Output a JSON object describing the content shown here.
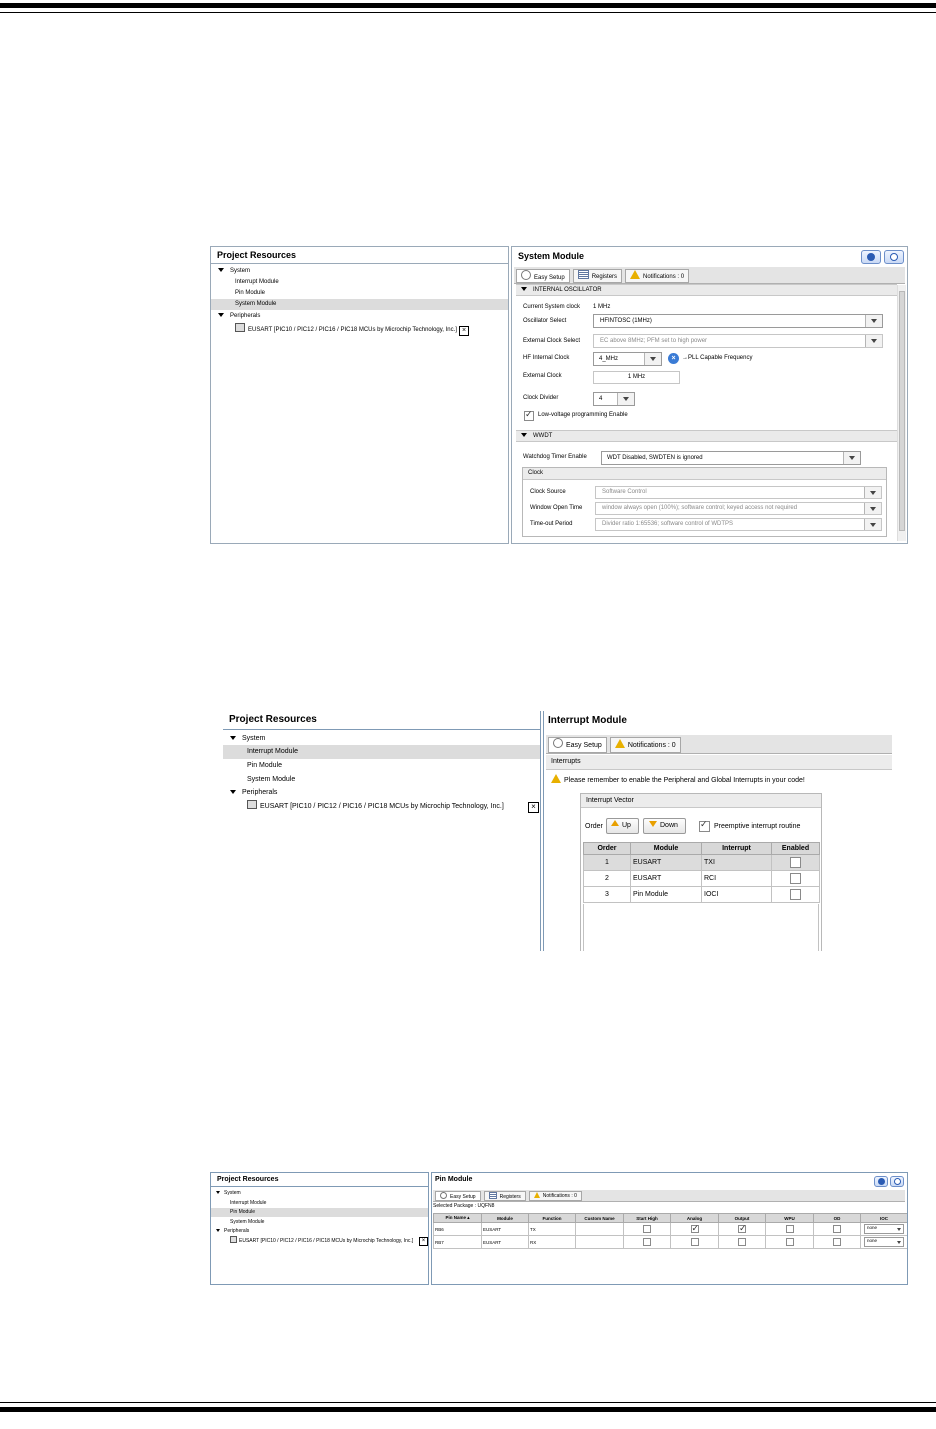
{
  "shot1": {
    "project_resources": {
      "title": "Project Resources",
      "system_label": "System",
      "interrupt_module": "Interrupt Module",
      "pin_module": "Pin Module",
      "system_module": "System Module",
      "peripherals_label": "Peripherals",
      "eusart": "EUSART [PIC10 / PIC12 / PIC16 / PIC18 MCUs  by Microchip Technology, Inc.]"
    },
    "system_module": {
      "title": "System Module",
      "tabs": [
        "Easy Setup",
        "Registers",
        "Notifications : 0"
      ],
      "internal_osc_header": "INTERNAL OSCILLATOR",
      "current_clock_label": "Current System clock",
      "current_clock_value": "1 MHz",
      "osc_select_label": "Oscillator Select",
      "osc_select_value": "HFINTOSC (1MHz)",
      "ext_clock_select_label": "External Clock Select",
      "ext_clock_select_value": "EC above 8MHz; PFM set to high power",
      "hf_internal_clock_label": "HF Internal Clock",
      "hf_internal_clock_value": "4_MHz",
      "pll_label": "PLL Capable Frequency",
      "external_clock_label": "External Clock",
      "external_clock_value": "1 MHz",
      "clock_divider_label": "Clock Divider",
      "clock_divider_value": "4",
      "lvp_label": "Low-voltage programming Enable",
      "wwdt_header": "WWDT",
      "wdt_enable_label": "Watchdog Timer Enable",
      "wdt_enable_value": "WDT Disabled, SWDTEN is ignored",
      "clock_group": "Clock",
      "clock_source_label": "Clock Source",
      "clock_source_value": "Software Control",
      "window_open_label": "Window Open Time",
      "window_open_value": "window always open (100%); software control; keyed access not required",
      "timeout_label": "Time-out Period",
      "timeout_value": "Divider ratio 1:65536; software control of WDTPS"
    }
  },
  "shot2": {
    "project_resources": {
      "title": "Project Resources",
      "system_label": "System",
      "interrupt_module": "Interrupt Module",
      "pin_module": "Pin Module",
      "system_module": "System Module",
      "peripherals_label": "Peripherals",
      "eusart": "EUSART [PIC10 / PIC12 / PIC16 / PIC18 MCUs  by Microchip Technology, Inc.]"
    },
    "interrupt_module": {
      "title": "Interrupt Module",
      "tabs": [
        "Easy Setup",
        "Notifications : 0"
      ],
      "section": "Interrupts",
      "warning": "Please remember to enable the Peripheral and Global Interrupts in your code!",
      "vector_group": "Interrupt Vector",
      "order_label": "Order",
      "up_label": "Up",
      "down_label": "Down",
      "preemptive_label": "Preemptive interrupt routine",
      "columns": [
        "Order",
        "Module",
        "Interrupt",
        "Enabled"
      ],
      "rows": [
        [
          "1",
          "EUSART",
          "TXI"
        ],
        [
          "2",
          "EUSART",
          "RCI"
        ],
        [
          "3",
          "Pin Module",
          "IOCI"
        ]
      ]
    }
  },
  "shot3": {
    "project_resources": {
      "title": "Project Resources",
      "system_label": "System",
      "interrupt_module": "Interrupt Module",
      "pin_module": "Pin Module",
      "system_module": "System Module",
      "peripherals_label": "Peripherals",
      "eusart": "EUSART [PIC10 / PIC12 / PIC16 / PIC18 MCUs  by Microchip Technology, Inc.]"
    },
    "pin_module": {
      "title": "Pin Module",
      "tabs": [
        "Easy Setup",
        "Registers",
        "Notifications : 0"
      ],
      "selected_package": "Selected Package : UQFN8",
      "columns": [
        "Pin Name",
        "Module",
        "Function",
        "Custom Name",
        "Start High",
        "Analog",
        "Output",
        "WPU",
        "OD",
        "IOC"
      ],
      "rows": [
        {
          "pin": "RB6",
          "module": "EUSART",
          "function": "TX",
          "analog": true,
          "output": true,
          "ioc": "none"
        },
        {
          "pin": "RB7",
          "module": "EUSART",
          "function": "RX",
          "analog": false,
          "output": false,
          "ioc": "none"
        }
      ]
    }
  }
}
